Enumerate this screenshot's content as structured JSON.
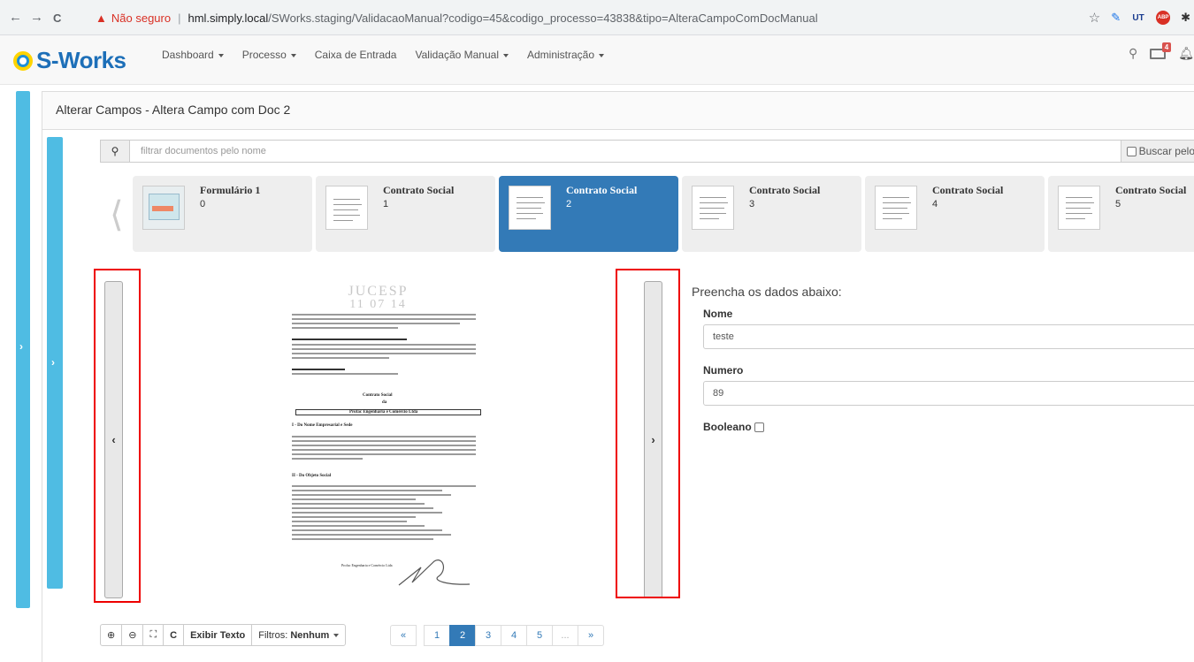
{
  "browser": {
    "back_glyph": "←",
    "forward_glyph": "→",
    "reload_glyph": "C",
    "insecure_label": "Não seguro",
    "host": "hml.simply.local",
    "path": "/SWorks.staging/ValidacaoManual?codigo=45&codigo_processo=43838&tipo=AlteraCampoComDocManual",
    "ext_star": "☆",
    "ext_ut": "UT",
    "ext_abp": "ABP",
    "ext_puzzle": "✱"
  },
  "app": {
    "brand": "S-Works",
    "menu": [
      {
        "label": "Dashboard",
        "dropdown": true
      },
      {
        "label": "Processo",
        "dropdown": true
      },
      {
        "label": "Caixa de Entrada",
        "dropdown": false
      },
      {
        "label": "Validação Manual",
        "dropdown": true
      },
      {
        "label": "Administração",
        "dropdown": true
      }
    ],
    "notification_count": "4"
  },
  "panel": {
    "title": "Alterar Campos - Altera Campo com Doc 2"
  },
  "search": {
    "placeholder": "filtrar documentos pelo nome",
    "checkbox_label": "Buscar pelo"
  },
  "documents": [
    {
      "name": "Formulário 1",
      "index": "0",
      "active": false
    },
    {
      "name": "Contrato Social",
      "index": "1",
      "active": false
    },
    {
      "name": "Contrato Social",
      "index": "2",
      "active": true
    },
    {
      "name": "Contrato Social",
      "index": "3",
      "active": false
    },
    {
      "name": "Contrato Social",
      "index": "4",
      "active": false
    },
    {
      "name": "Contrato Social",
      "index": "5",
      "active": false
    }
  ],
  "viewer": {
    "prev_glyph": "‹",
    "next_glyph": "›",
    "page_stamp_1": "JUCESP",
    "page_stamp_2": "11 07 14",
    "page_heading_1": "Contrato Social",
    "page_heading_2": "da",
    "page_heading_3": "Profac Engenharia e Comércio Ltda",
    "section_1": "I - Do Nome Empresarial e Sede",
    "section_2": "II - Do Objeto Social",
    "footer_name": "Profac Engenharia e Comércio Ltda"
  },
  "form": {
    "title": "Preencha os dados abaixo:",
    "fields": [
      {
        "label": "Nome",
        "value": "teste"
      },
      {
        "label": "Numero",
        "value": "89"
      }
    ],
    "boolean_label": "Booleano"
  },
  "toolbar": {
    "zoom_in_glyph": "⊕",
    "zoom_out_glyph": "⊖",
    "fit_glyph": "⛶",
    "rotate_glyph": "C",
    "show_text": "Exibir Texto",
    "filters_label": "Filtros:",
    "filters_value": "Nenhum"
  },
  "pagination": {
    "first": "«",
    "pages": [
      "1",
      "2",
      "3",
      "4",
      "5"
    ],
    "current": "2",
    "ellipsis": "...",
    "last": "»"
  },
  "colors": {
    "primary": "#337ab7",
    "side_tab": "#4fbce3",
    "brand": "#1d6fb8",
    "highlight_box": "#e00000"
  }
}
